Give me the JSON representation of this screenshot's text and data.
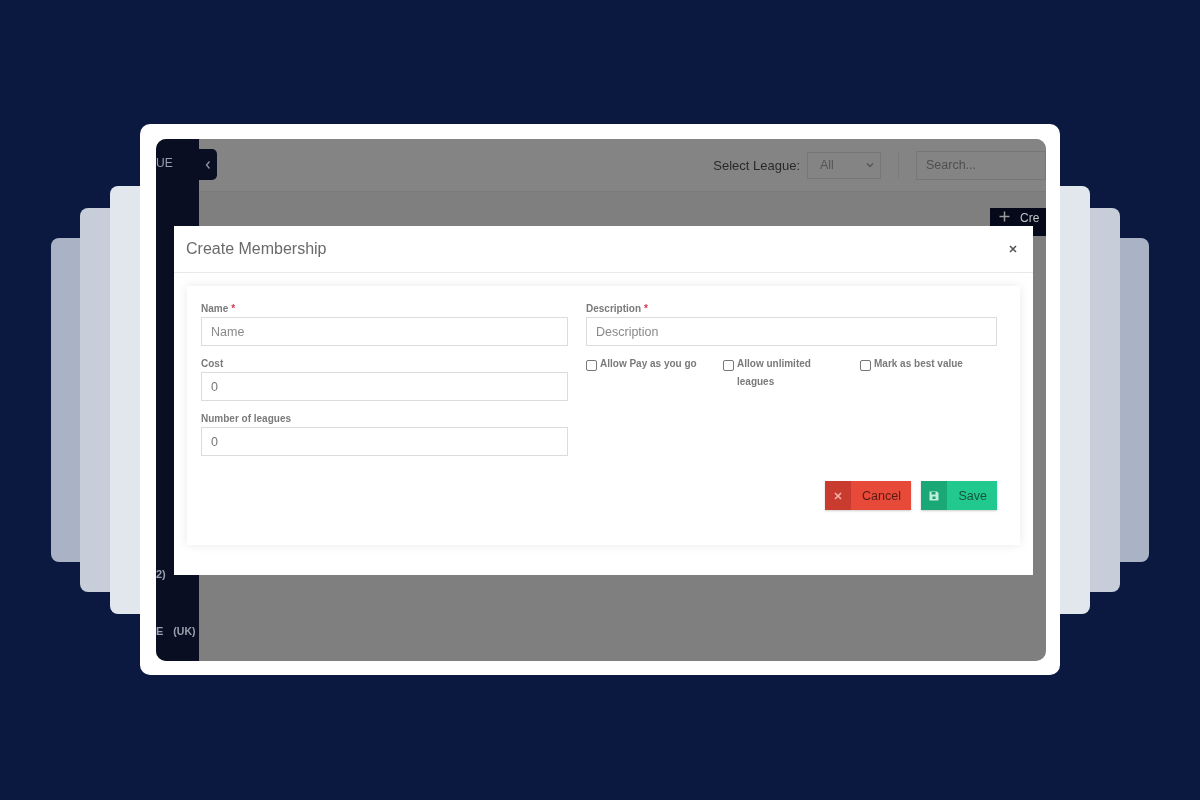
{
  "sidebar": {
    "brand": "UE",
    "items": [
      {
        "label": "2)"
      },
      {
        "label": "E",
        "badge": "(UK)"
      }
    ]
  },
  "topbar": {
    "select_label": "Select League:",
    "select_value": "All",
    "search_placeholder": "Search..."
  },
  "page": {
    "create_button": "Cre"
  },
  "modal": {
    "title": "Create Membership",
    "left_fields": [
      {
        "label": "Name",
        "marker": "*",
        "placeholder": "Name"
      },
      {
        "label": "Cost",
        "value": "0"
      },
      {
        "label": "Number of leagues",
        "value": "0"
      }
    ],
    "right_fields": [
      {
        "label": "Description",
        "marker": "*",
        "placeholder": "Description"
      }
    ],
    "checkboxes": [
      {
        "label": "Allow Pay as you go",
        "checked": false
      },
      {
        "label": "Allow unlimited leagues",
        "checked": false
      },
      {
        "label": "Mark as best value",
        "checked": false
      }
    ],
    "buttons": [
      {
        "label": "Cancel",
        "kind": "cancel"
      },
      {
        "label": "Save",
        "kind": "save"
      }
    ]
  }
}
